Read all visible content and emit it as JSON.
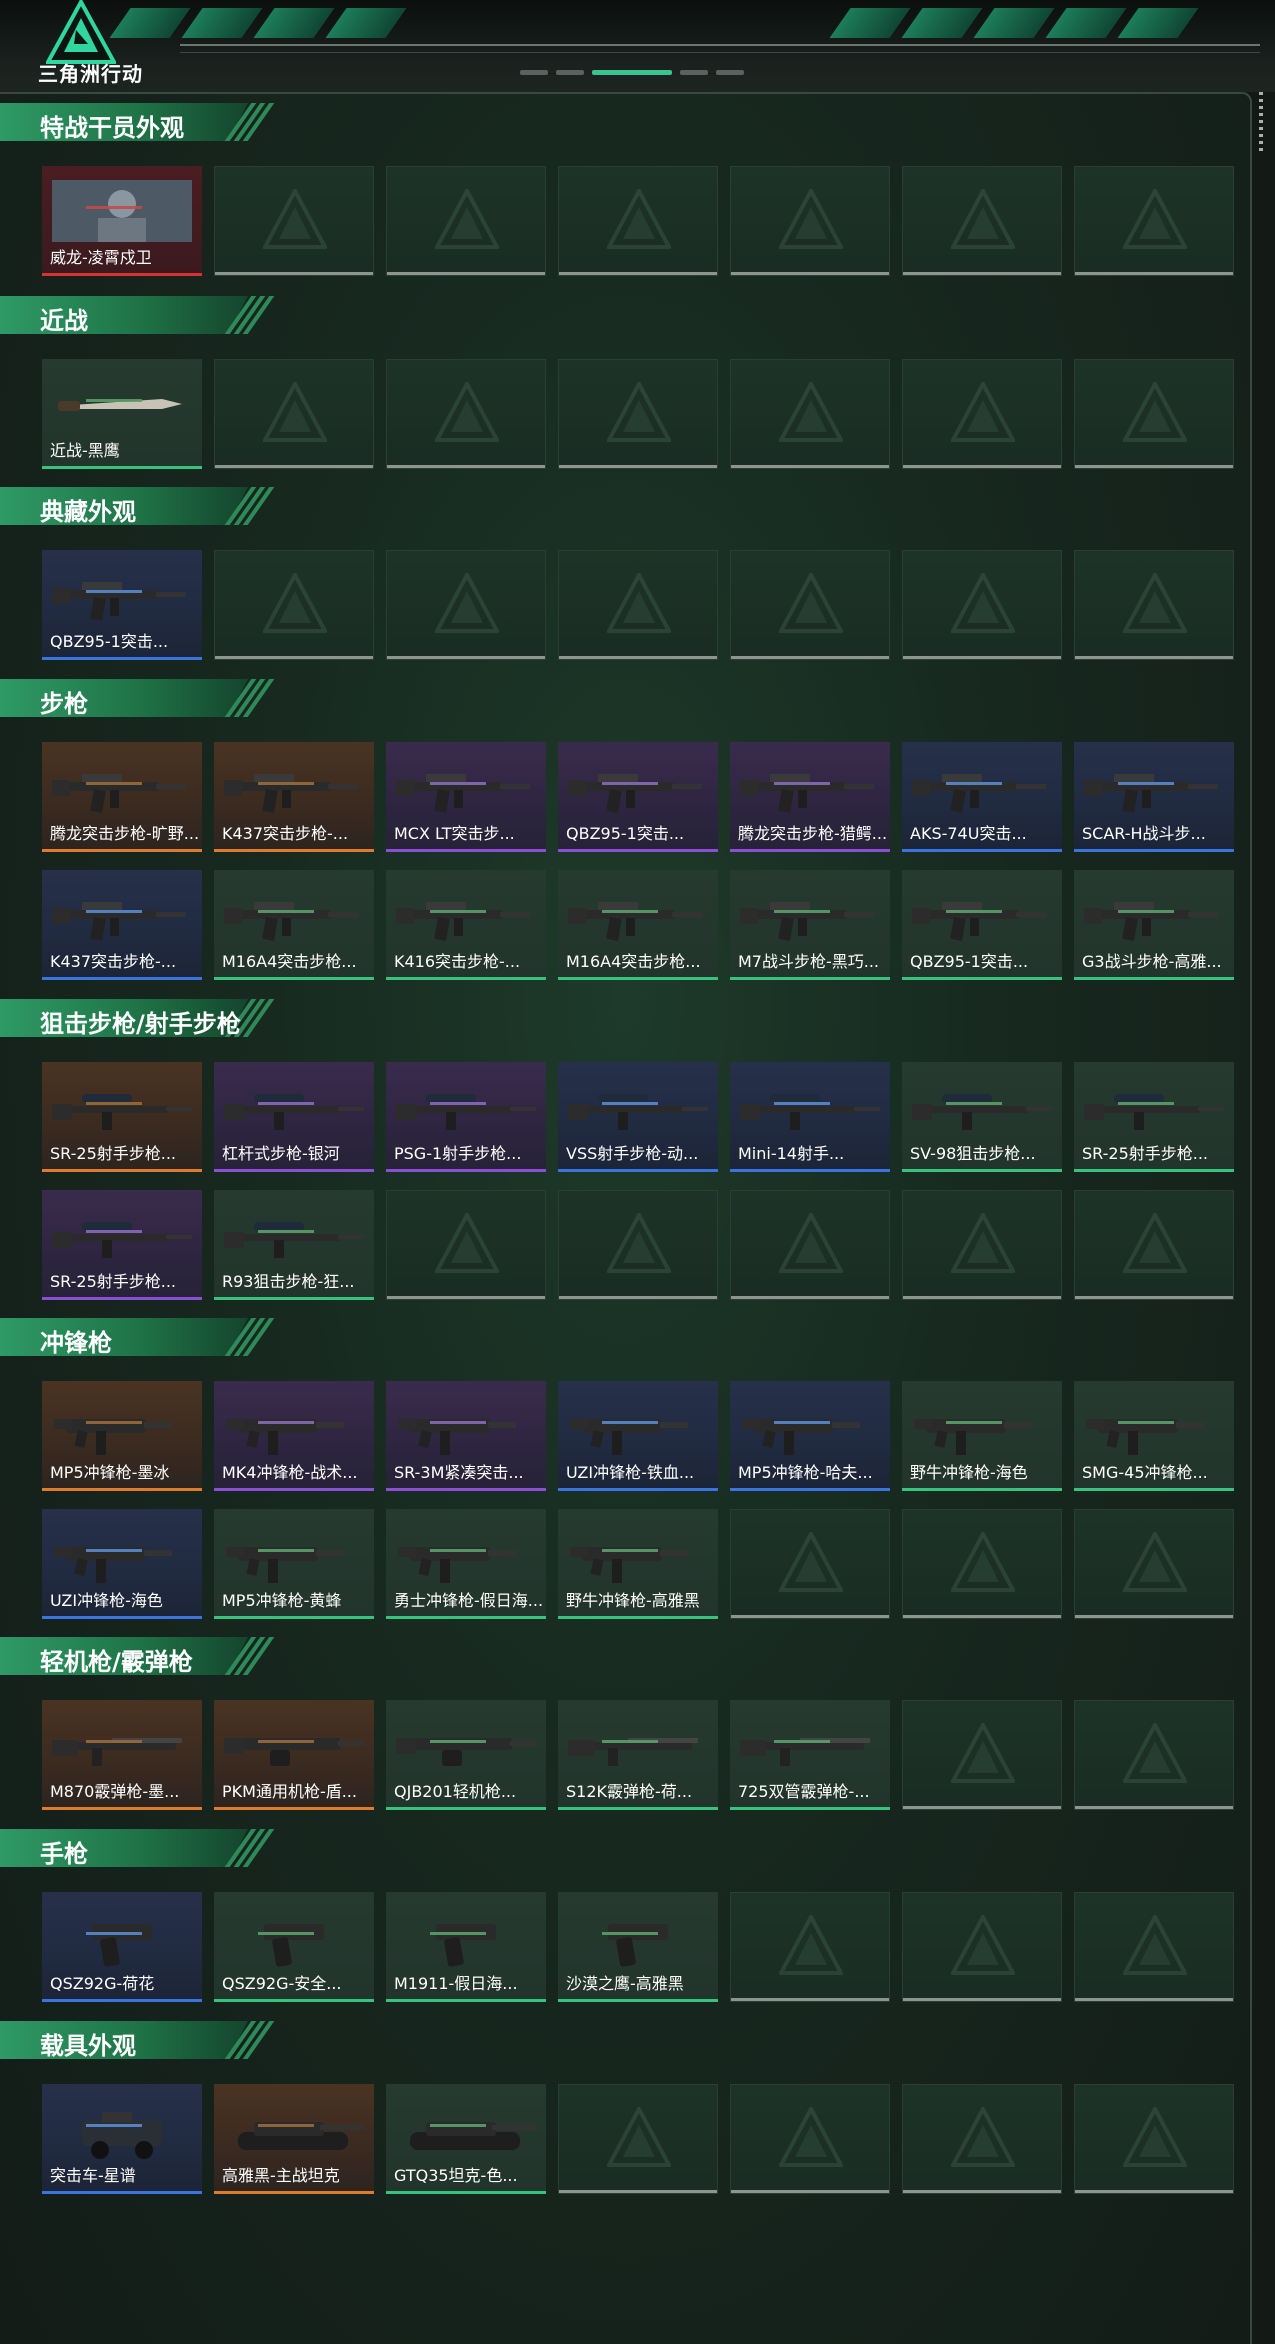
{
  "app": {
    "logo_text": "三角洲行动",
    "logo_icon": "delta-triangle-logo"
  },
  "colors": {
    "accent": "#2e9a66",
    "quality_orange": "#e07b2a",
    "quality_purple": "#8b4ed6",
    "quality_blue": "#3a74e0",
    "quality_red": "#d63434",
    "quality_green": "#36c37d"
  },
  "sections": [
    {
      "title": "特战干员外观",
      "items": [
        {
          "label": "威龙-凌霄戍卫",
          "quality": "red",
          "icon": "operator-portrait-icon"
        }
      ]
    },
    {
      "title": "近战",
      "items": [
        {
          "label": "近战-黑鹰",
          "quality": "green",
          "icon": "knife-icon"
        }
      ]
    },
    {
      "title": "典藏外观",
      "items": [
        {
          "label": "QBZ95-1突击...",
          "quality": "blue",
          "icon": "rifle-icon"
        }
      ]
    },
    {
      "title": "步枪",
      "items": [
        {
          "label": "腾龙突击步枪-旷野...",
          "quality": "orange",
          "icon": "rifle-icon"
        },
        {
          "label": "K437突击步枪-...",
          "quality": "orange",
          "icon": "rifle-icon"
        },
        {
          "label": "MCX LT突击步...",
          "quality": "purple",
          "icon": "rifle-icon"
        },
        {
          "label": "QBZ95-1突击...",
          "quality": "purple",
          "icon": "rifle-icon"
        },
        {
          "label": "腾龙突击步枪-猎鳄...",
          "quality": "purple",
          "icon": "rifle-icon"
        },
        {
          "label": "AKS-74U突击...",
          "quality": "blue",
          "icon": "rifle-icon"
        },
        {
          "label": "SCAR-H战斗步...",
          "quality": "blue",
          "icon": "rifle-icon"
        },
        {
          "label": "K437突击步枪-...",
          "quality": "blue",
          "icon": "rifle-icon"
        },
        {
          "label": "M16A4突击步枪...",
          "quality": "green",
          "icon": "rifle-icon"
        },
        {
          "label": "K416突击步枪-...",
          "quality": "green",
          "icon": "rifle-icon"
        },
        {
          "label": "M16A4突击步枪...",
          "quality": "green",
          "icon": "rifle-icon"
        },
        {
          "label": "M7战斗步枪-黑巧...",
          "quality": "green",
          "icon": "rifle-icon"
        },
        {
          "label": "QBZ95-1突击...",
          "quality": "green",
          "icon": "rifle-icon"
        },
        {
          "label": "G3战斗步枪-高雅...",
          "quality": "green",
          "icon": "rifle-icon"
        }
      ]
    },
    {
      "title": "狙击步枪/射手步枪",
      "items": [
        {
          "label": "SR-25射手步枪...",
          "quality": "orange",
          "icon": "sniper-icon"
        },
        {
          "label": "杠杆式步枪-银河",
          "quality": "purple",
          "icon": "sniper-icon"
        },
        {
          "label": "PSG-1射手步枪...",
          "quality": "purple",
          "icon": "sniper-icon"
        },
        {
          "label": "VSS射手步枪-动...",
          "quality": "blue",
          "icon": "sniper-icon"
        },
        {
          "label": "Mini-14射手...",
          "quality": "blue",
          "icon": "sniper-icon"
        },
        {
          "label": "SV-98狙击步枪...",
          "quality": "green",
          "icon": "sniper-icon"
        },
        {
          "label": "SR-25射手步枪...",
          "quality": "green",
          "icon": "sniper-icon"
        },
        {
          "label": "SR-25射手步枪...",
          "quality": "purple",
          "icon": "sniper-icon"
        },
        {
          "label": "R93狙击步枪-狂...",
          "quality": "green",
          "icon": "sniper-icon"
        }
      ]
    },
    {
      "title": "冲锋枪",
      "items": [
        {
          "label": "MP5冲锋枪-墨冰",
          "quality": "orange",
          "icon": "smg-icon"
        },
        {
          "label": "MK4冲锋枪-战术...",
          "quality": "purple",
          "icon": "smg-icon"
        },
        {
          "label": "SR-3M紧凑突击...",
          "quality": "purple",
          "icon": "smg-icon"
        },
        {
          "label": "UZI冲锋枪-铁血...",
          "quality": "blue",
          "icon": "smg-icon"
        },
        {
          "label": "MP5冲锋枪-哈夫...",
          "quality": "blue",
          "icon": "smg-icon"
        },
        {
          "label": "野牛冲锋枪-海色",
          "quality": "green",
          "icon": "smg-icon"
        },
        {
          "label": "SMG-45冲锋枪...",
          "quality": "green",
          "icon": "smg-icon"
        },
        {
          "label": "UZI冲锋枪-海色",
          "quality": "blue",
          "icon": "smg-icon"
        },
        {
          "label": "MP5冲锋枪-黄蜂",
          "quality": "green",
          "icon": "smg-icon"
        },
        {
          "label": "勇士冲锋枪-假日海...",
          "quality": "green",
          "icon": "smg-icon"
        },
        {
          "label": "野牛冲锋枪-高雅黑",
          "quality": "green",
          "icon": "smg-icon"
        }
      ]
    },
    {
      "title": "轻机枪/霰弹枪",
      "items": [
        {
          "label": "M870霰弹枪-墨...",
          "quality": "orange",
          "icon": "shotgun-icon"
        },
        {
          "label": "PKM通用机枪-盾...",
          "quality": "orange",
          "icon": "lmg-icon"
        },
        {
          "label": "QJB201轻机枪...",
          "quality": "green",
          "icon": "lmg-icon"
        },
        {
          "label": "S12K霰弹枪-荷...",
          "quality": "green",
          "icon": "shotgun-icon"
        },
        {
          "label": "725双管霰弹枪-...",
          "quality": "green",
          "icon": "shotgun-icon"
        }
      ]
    },
    {
      "title": "手枪",
      "items": [
        {
          "label": "QSZ92G-荷花",
          "quality": "blue",
          "icon": "pistol-icon"
        },
        {
          "label": "QSZ92G-安全...",
          "quality": "green",
          "icon": "pistol-icon"
        },
        {
          "label": "M1911-假日海...",
          "quality": "green",
          "icon": "pistol-icon"
        },
        {
          "label": "沙漠之鹰-高雅黑",
          "quality": "green",
          "icon": "pistol-icon"
        }
      ]
    },
    {
      "title": "载具外观",
      "items": [
        {
          "label": "突击车-星谱",
          "quality": "blue",
          "icon": "vehicle-icon"
        },
        {
          "label": "高雅黑-主战坦克",
          "quality": "orange",
          "icon": "tank-icon"
        },
        {
          "label": "GTQ35坦克-色...",
          "quality": "green",
          "icon": "tank-icon"
        }
      ]
    }
  ]
}
